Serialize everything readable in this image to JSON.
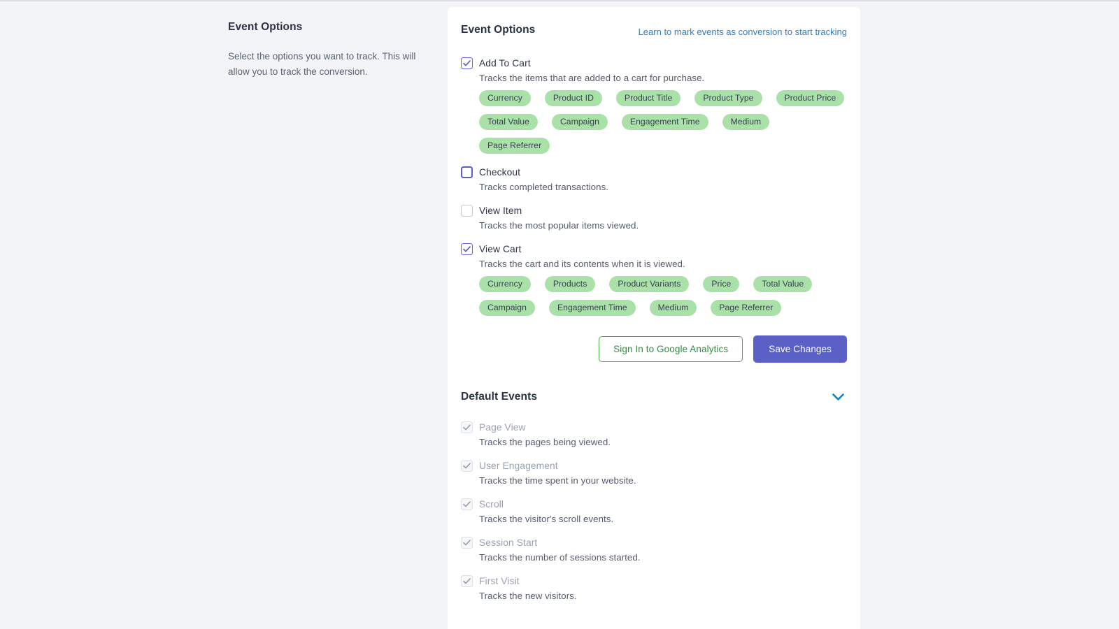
{
  "sidebar": {
    "title": "Event Options",
    "description": "Select the options you want to track. This will allow you to track the conversion."
  },
  "event_options_card": {
    "title": "Event Options",
    "help_link": "Learn to mark events as conversion to start tracking",
    "events": [
      {
        "label": "Add To Cart",
        "description": "Tracks the items that are added to a cart for purchase.",
        "checked": true,
        "focused": false,
        "tags": [
          "Currency",
          "Product ID",
          "Product Title",
          "Product Type",
          "Product Price",
          "Total Value",
          "Campaign",
          "Engagement Time",
          "Medium",
          "Page Referrer"
        ]
      },
      {
        "label": "Checkout",
        "description": "Tracks completed transactions.",
        "checked": false,
        "focused": true,
        "tags": []
      },
      {
        "label": "View Item",
        "description": "Tracks the most popular items viewed.",
        "checked": false,
        "focused": false,
        "tags": []
      },
      {
        "label": "View Cart",
        "description": "Tracks the cart and its contents when it is viewed.",
        "checked": true,
        "focused": false,
        "tags": [
          "Currency",
          "Products",
          "Product Variants",
          "Price",
          "Total Value",
          "Campaign",
          "Engagement Time",
          "Medium",
          "Page Referrer"
        ]
      }
    ],
    "sign_in_button": "Sign In to Google Analytics",
    "save_button": "Save Changes"
  },
  "default_events_card": {
    "title": "Default Events",
    "collapse_icon": "chevron-down-icon",
    "events": [
      {
        "label": "Page View",
        "description": "Tracks the pages being viewed.",
        "checked": true,
        "disabled": true
      },
      {
        "label": "User Engagement",
        "description": "Tracks the time spent in your website.",
        "checked": true,
        "disabled": true
      },
      {
        "label": "Scroll",
        "description": "Tracks the visitor's scroll events.",
        "checked": true,
        "disabled": true
      },
      {
        "label": "Session Start",
        "description": "Tracks the number of sessions started.",
        "checked": true,
        "disabled": true
      },
      {
        "label": "First Visit",
        "description": "Tracks the new visitors.",
        "checked": true,
        "disabled": true
      }
    ]
  },
  "colors": {
    "page_background": "#f3f4f7",
    "card_background": "#ffffff",
    "tag_green": "#a9e1a9",
    "primary_indigo": "#5b60c6",
    "link_blue": "#2f80c2",
    "outline_green": "#4aa84a",
    "chevron_blue": "#1a7bbf"
  }
}
